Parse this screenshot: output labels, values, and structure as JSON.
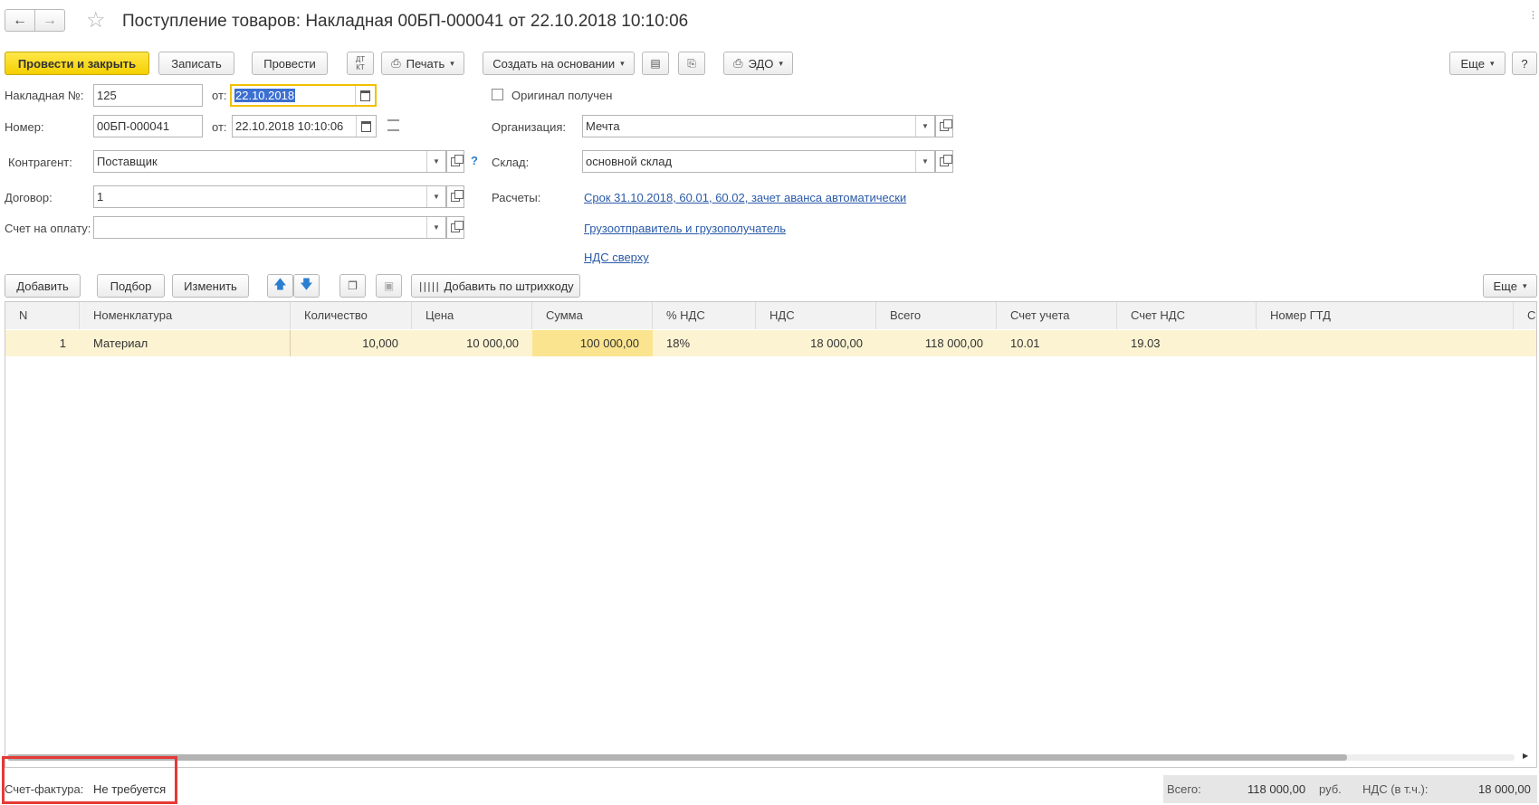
{
  "nav": {
    "back_icon": "arrow-left-icon",
    "forward_icon": "arrow-right-icon",
    "star_icon": "star-icon"
  },
  "title": "Поступление товаров: Накладная 00БП-000041 от 22.10.2018 10:10:06",
  "toolbar": {
    "post_close": "Провести и закрыть",
    "save": "Записать",
    "post": "Провести",
    "dtkt_top": "ДТ",
    "dtkt_bottom": "КТ",
    "print": "Печать",
    "create_based": "Создать на основании",
    "edo": "ЭДО",
    "more": "Еще",
    "help": "?"
  },
  "form": {
    "invoice_no_label": "Накладная №:",
    "invoice_no_value": "125",
    "from_label": "от:",
    "invoice_date_value": "22.10.2018",
    "original_label": "Оригинал получен",
    "number_label": "Номер:",
    "number_value": "00БП-000041",
    "number_date_value": "22.10.2018 10:10:06",
    "org_label": "Организация:",
    "org_value": "Мечта",
    "counterparty_label": "Контрагент:",
    "counterparty_value": "Поставщик",
    "counterparty_help": "?",
    "warehouse_label": "Склад:",
    "warehouse_value": "основной склад",
    "contract_label": "Договор:",
    "contract_value": "1",
    "settlements_label": "Расчеты:",
    "settlements_link": "Срок 31.10.2018, 60.01, 60.02, зачет аванса автоматически",
    "payment_invoice_label": "Счет на оплату:",
    "payment_invoice_value": "",
    "shipper_link": "Грузоотправитель и грузополучатель",
    "vat_link": "НДС сверху"
  },
  "table_toolbar": {
    "add": "Добавить",
    "pick": "Подбор",
    "edit": "Изменить",
    "barcode": "Добавить по штрихкоду",
    "more": "Еще"
  },
  "table": {
    "headers": [
      "N",
      "Номенклатура",
      "Количество",
      "Цена",
      "Сумма",
      "% НДС",
      "НДС",
      "Всего",
      "Счет учета",
      "Счет НДС",
      "Номер ГТД",
      "С"
    ],
    "rows": [
      [
        "1",
        "Материал",
        "10,000",
        "10 000,00",
        "100 000,00",
        "18%",
        "18 000,00",
        "118 000,00",
        "10.01",
        "19.03",
        ""
      ]
    ]
  },
  "footer": {
    "invoice_label": "Счет-фактура:",
    "invoice_value": "Не требуется",
    "total_label": "Всего:",
    "total_value": "118 000,00",
    "currency": "руб.",
    "vat_label": "НДС (в т.ч.):",
    "vat_value": "18 000,00"
  },
  "colors": {
    "primary": "#f5cf00",
    "highlight": "#e53935",
    "link": "#2a5aa8",
    "row_selected": "#fbf3d2"
  }
}
